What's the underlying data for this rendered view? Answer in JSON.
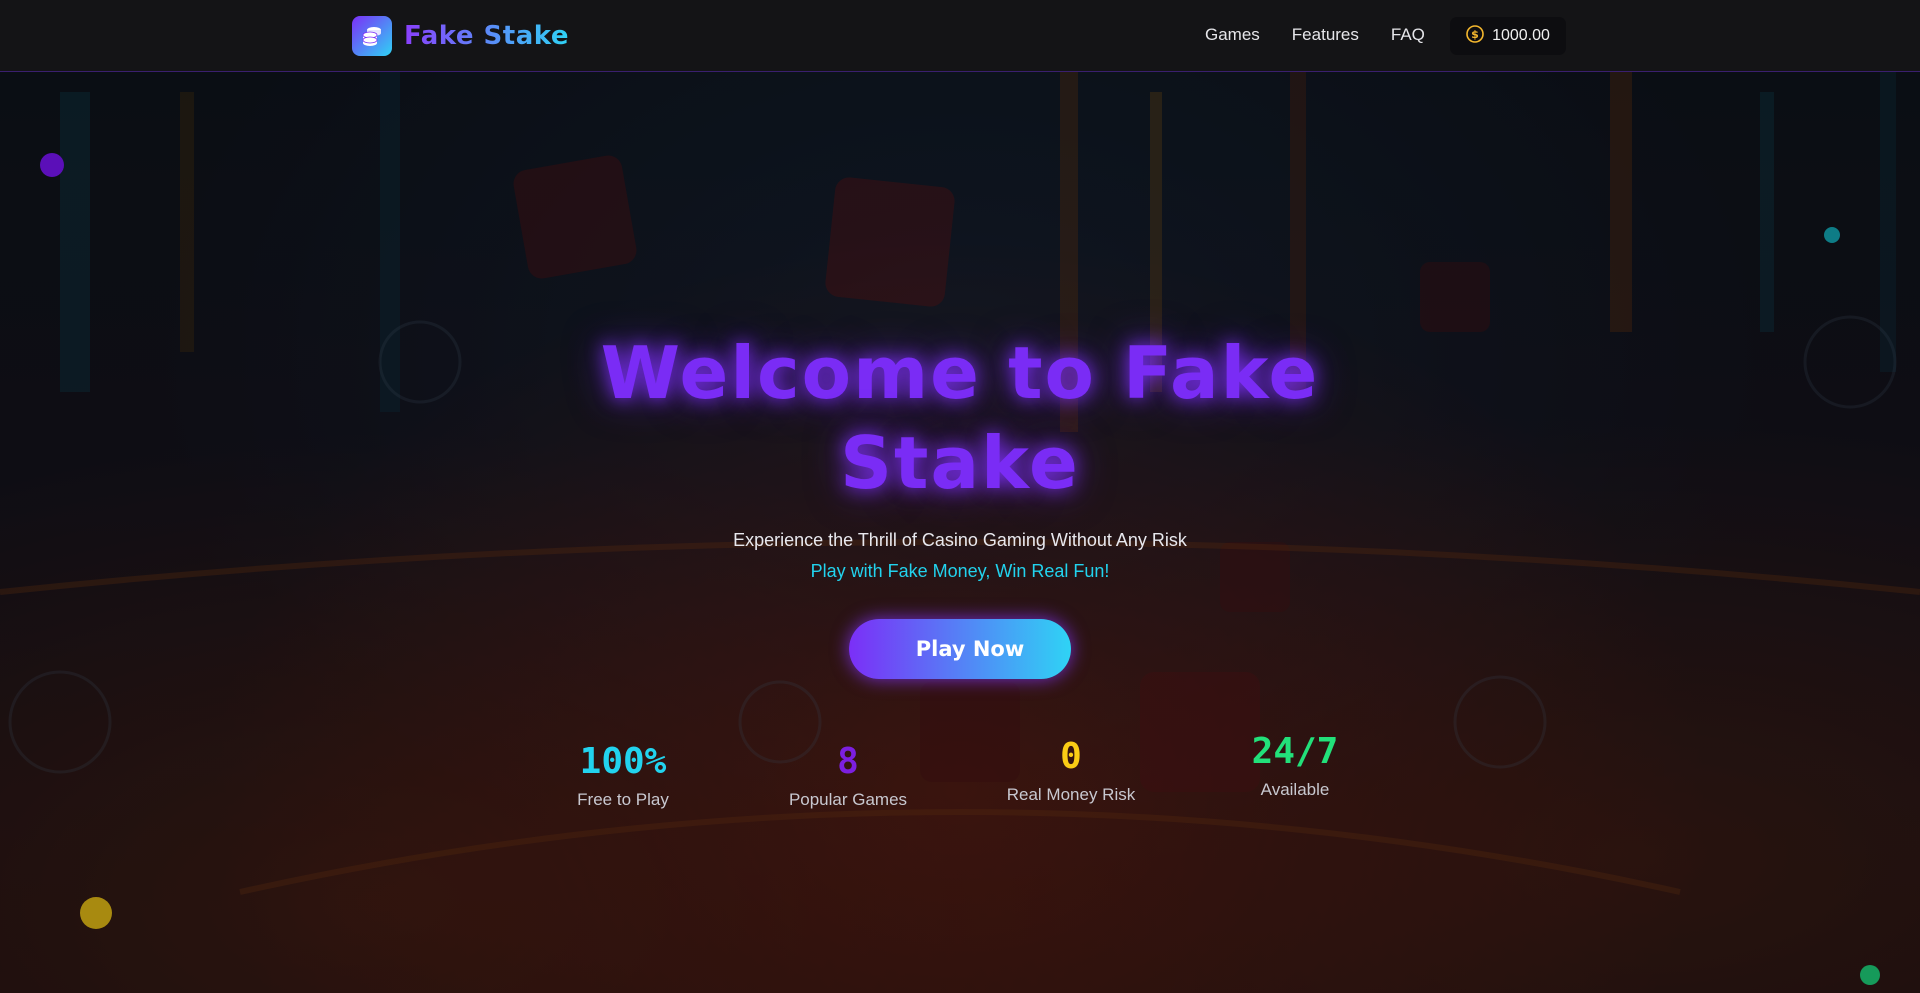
{
  "header": {
    "brand_name": "Fake Stake",
    "nav": [
      {
        "label": "Games"
      },
      {
        "label": "Features"
      },
      {
        "label": "FAQ"
      }
    ],
    "balance": "1000.00"
  },
  "hero": {
    "title_line1": "Welcome to Fake",
    "title_line2": "Stake",
    "subtitle": "Experience the Thrill of Casino Gaming Without Any Risk",
    "tagline": "Play with Fake Money, Win Real Fun!",
    "cta_label": "Play Now"
  },
  "stats": [
    {
      "value": "100%",
      "label": "Free to Play",
      "color": "#22d3ee"
    },
    {
      "value": "8",
      "label": "Popular Games",
      "color": "#7c1fe0"
    },
    {
      "value": "0",
      "label": "Real Money Risk",
      "color": "#facc15"
    },
    {
      "value": "24/7",
      "label": "Available",
      "color": "#22e07a"
    }
  ],
  "colors": {
    "accent_purple": "#7b2ff7",
    "accent_cyan": "#2fd3f5",
    "header_bg": "#141416"
  },
  "icons": {
    "brand": "stacked-coins-icon",
    "balance": "coin-icon"
  }
}
